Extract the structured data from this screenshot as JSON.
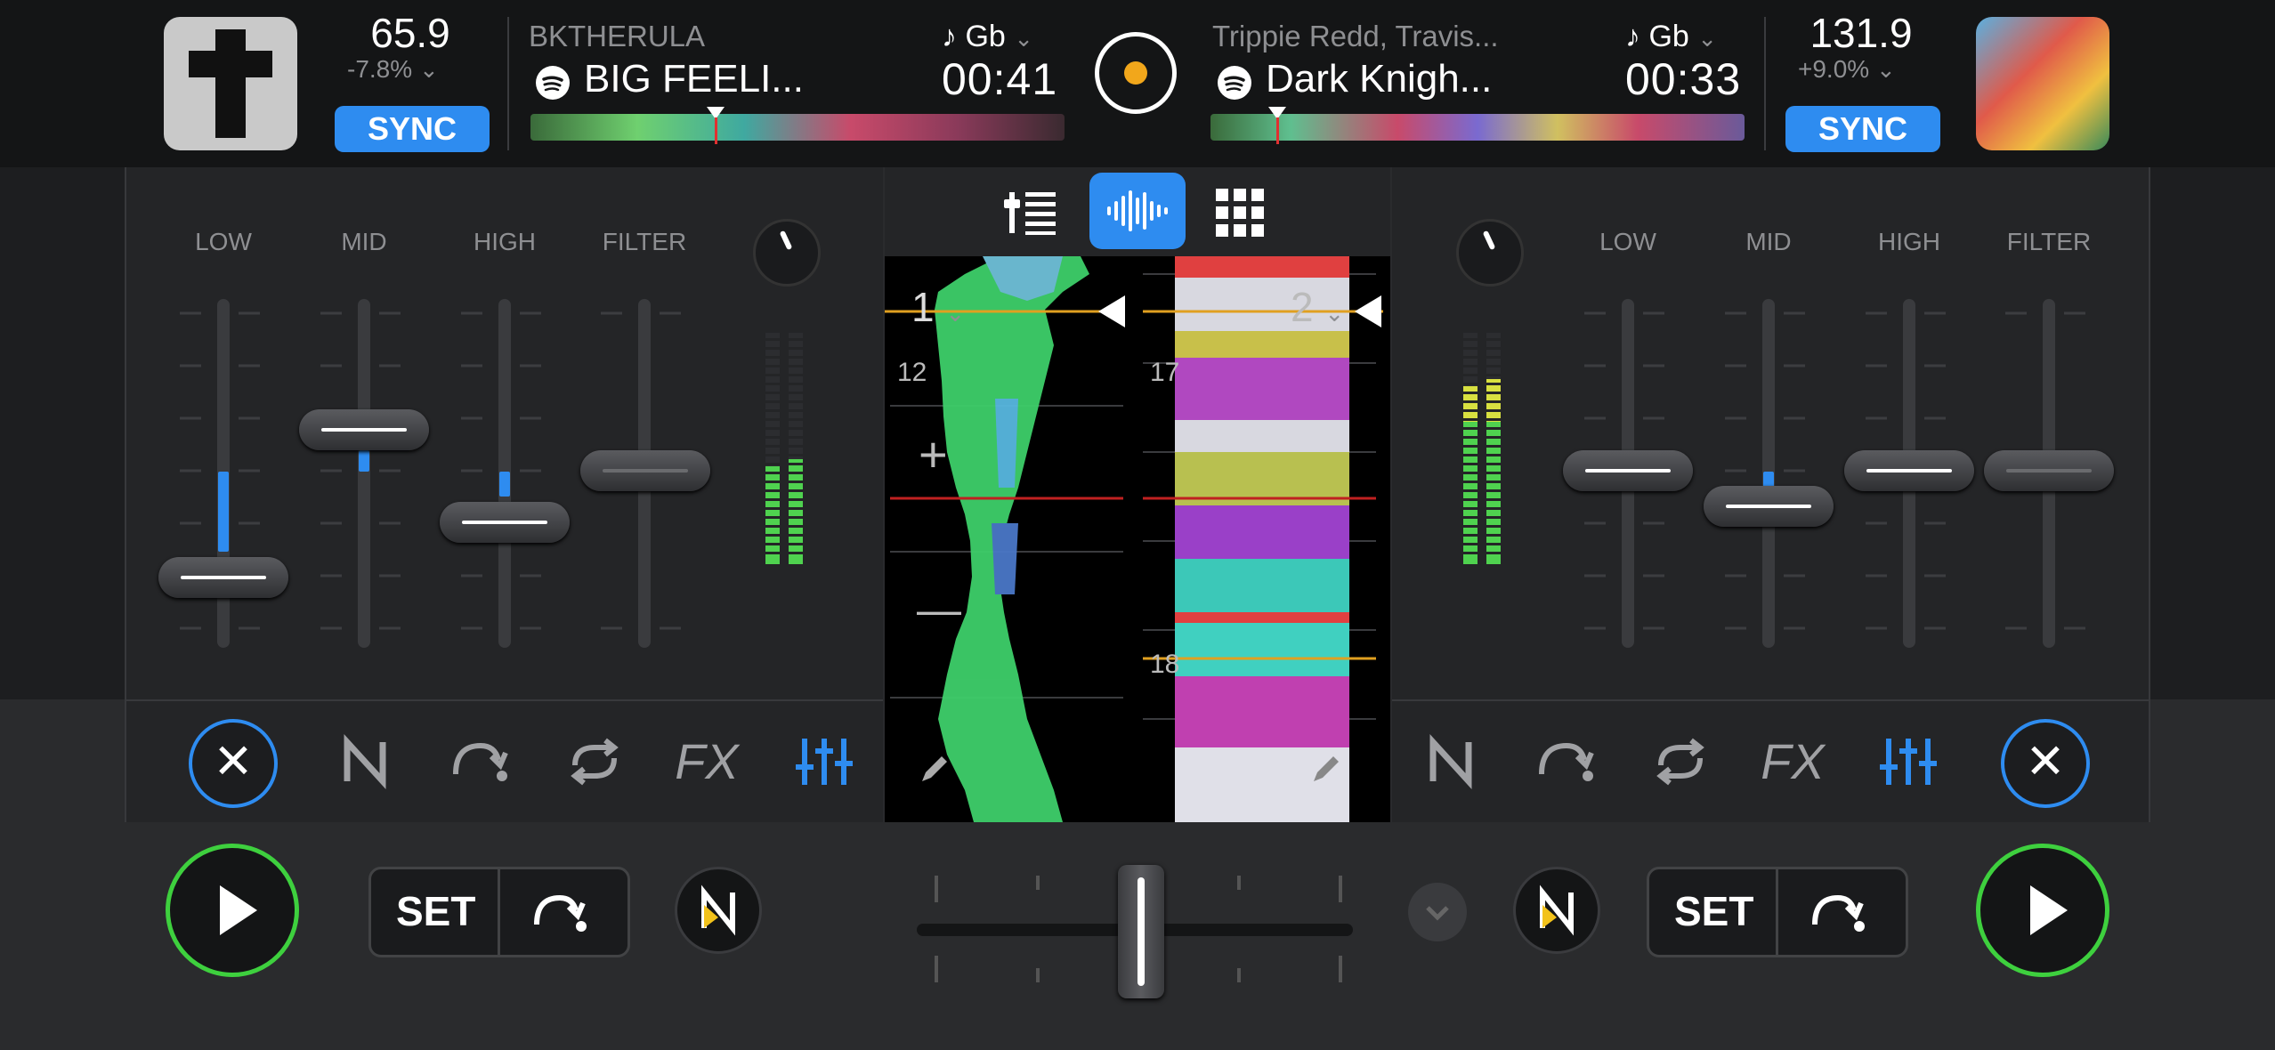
{
  "deck_left": {
    "bpm": "65.9",
    "pitch": "-7.8%",
    "sync_label": "SYNC",
    "artist": "BKTHERULA",
    "title": "BIG FEELI...",
    "key": "Gb",
    "time": "00:41",
    "eq_labels": [
      "LOW",
      "MID",
      "HIGH",
      "FILTER"
    ],
    "set_label": "SET"
  },
  "deck_right": {
    "bpm": "131.9",
    "pitch": "+9.0%",
    "sync_label": "SYNC",
    "artist": "Trippie Redd, Travis...",
    "title": "Dark Knigh...",
    "key": "Gb",
    "time": "00:33",
    "eq_labels": [
      "LOW",
      "MID",
      "HIGH",
      "FILTER"
    ],
    "set_label": "SET"
  },
  "center": {
    "deck1_number": "1",
    "deck2_number": "2",
    "beat_left_1": "12",
    "beat_right_1": "17",
    "beat_right_2": "18",
    "plus": "+",
    "minus": "—"
  },
  "icons": {
    "fx_label": "FX",
    "close": "✕",
    "play": "▶"
  },
  "colors": {
    "accent": "#2e8cf0",
    "play_ring": "#3ed03e",
    "meter_green": "#4fd24f",
    "meter_yellow": "#d8e040"
  }
}
